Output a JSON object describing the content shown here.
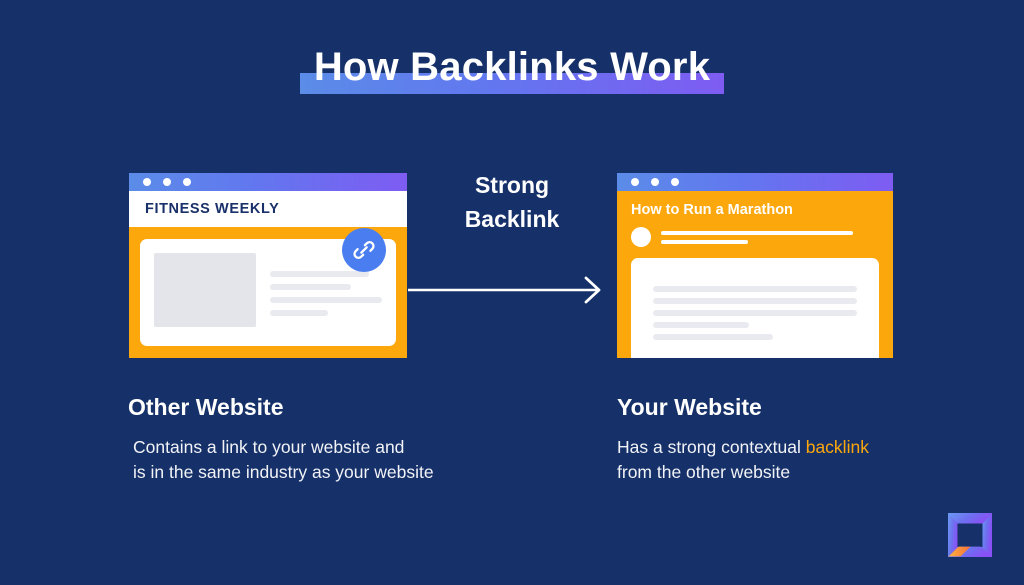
{
  "theme": {
    "background": "#163169",
    "orange": "#fca70c",
    "gradient_start": "#5b8ce8",
    "gradient_end": "#7e5cf2",
    "link_badge_blue": "#4a7ef0",
    "text_white": "#ffffff"
  },
  "header": {
    "title": "How Backlinks Work"
  },
  "connector": {
    "label_line1": "Strong",
    "label_line2": "Backlink",
    "arrow_icon": "arrow-right-icon"
  },
  "left_window": {
    "dots": [
      "dot-1",
      "dot-2",
      "dot-3"
    ],
    "site_name": "FITNESS WEEKLY",
    "badge_icon": "link-chain-icon",
    "content_lines": [
      88,
      72,
      100,
      52
    ]
  },
  "right_window": {
    "dots": [
      "dot-1",
      "dot-2",
      "dot-3"
    ],
    "article_title": "How to Run a Marathon",
    "byline_lines": [
      88,
      40
    ],
    "content_lines": [
      100,
      100,
      100,
      47,
      59
    ]
  },
  "left_caption": {
    "title": "Other Website",
    "line1": "Contains a link to your website and",
    "line2": "is in the same industry as your website"
  },
  "right_caption": {
    "title": "Your Website",
    "line1_prefix": "Has a strong contextual ",
    "line1_highlight": "backlink",
    "line2": "from the other website"
  },
  "logo": {
    "name": "brand-logo"
  }
}
